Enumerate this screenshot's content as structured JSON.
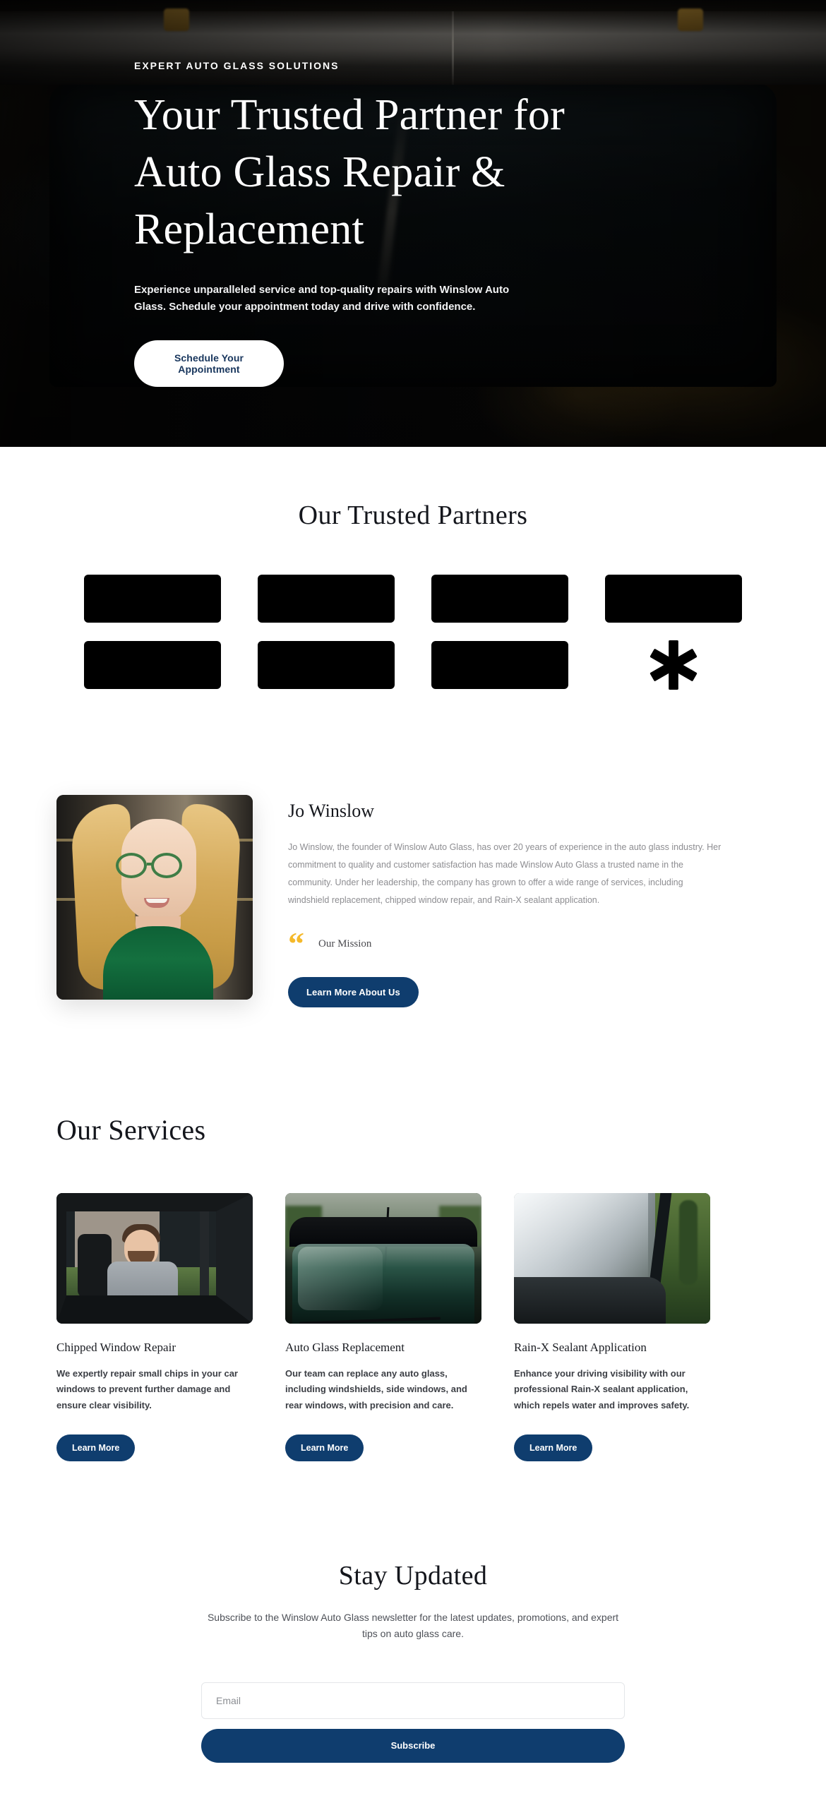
{
  "hero": {
    "eyebrow": "EXPERT AUTO GLASS SOLUTIONS",
    "title": "Your Trusted Partner for Auto Glass Repair & Replacement",
    "subtitle": "Experience unparalleled service and top-quality repairs with Winslow Auto Glass. Schedule your appointment today and drive with confidence.",
    "cta_label": "Schedule Your Appointment",
    "background_image_alt": "dark vehicle windshield close-up"
  },
  "partners": {
    "title": "Our Trusted Partners",
    "logos": [
      {
        "type": "block",
        "alt": "partner-logo-1"
      },
      {
        "type": "block",
        "alt": "partner-logo-2"
      },
      {
        "type": "block",
        "alt": "partner-logo-3"
      },
      {
        "type": "block",
        "alt": "partner-logo-4"
      },
      {
        "type": "block",
        "alt": "partner-logo-5"
      },
      {
        "type": "block",
        "alt": "partner-logo-6"
      },
      {
        "type": "block",
        "alt": "partner-logo-7"
      },
      {
        "type": "asterisk",
        "alt": "partner-logo-asterisk"
      }
    ]
  },
  "founder": {
    "photo_alt": "Jo Winslow portrait, blonde woman with green glasses and green top",
    "name": "Jo Winslow",
    "bio": "Jo Winslow, the founder of Winslow Auto Glass, has over 20 years of experience in the auto glass industry. Her commitment to quality and customer satisfaction has made Winslow Auto Glass a trusted name in the community. Under her leadership, the company has grown to offer a wide range of services, including windshield replacement, chipped window repair, and Rain-X sealant application.",
    "quote_glyph": "“",
    "mission_label": "Our Mission",
    "cta_label": "Learn More About Us"
  },
  "services": {
    "title": "Our Services",
    "cards": [
      {
        "image_alt": "man sitting in car driver seat through open window",
        "title": "Chipped Window Repair",
        "text": "We expertly repair small chips in your car windows to prevent further damage and ensure clear visibility.",
        "cta_label": "Learn More"
      },
      {
        "image_alt": "dark car windshield viewed from front with antenna",
        "title": "Auto Glass Replacement",
        "text": "Our team can replace any auto glass, including windshields, side windows, and rear windows, with precision and care.",
        "cta_label": "Learn More"
      },
      {
        "image_alt": "reflective car windshield with trees reflected",
        "title": "Rain-X Sealant Application",
        "text": "Enhance your driving visibility with our professional Rain-X sealant application, which repels water and improves safety.",
        "cta_label": "Learn More"
      }
    ]
  },
  "newsletter": {
    "title": "Stay Updated",
    "subtitle": "Subscribe to the Winslow Auto Glass newsletter for the latest updates, promotions, and expert tips on auto glass care.",
    "email_placeholder": "Email",
    "email_value": "",
    "submit_label": "Subscribe"
  },
  "colors": {
    "brand_navy": "#0f3d6e",
    "accent_yellow": "#f5b92a",
    "hero_text": "#ffffff",
    "page_bg": "#ffffff",
    "logo_block": "#000000"
  }
}
